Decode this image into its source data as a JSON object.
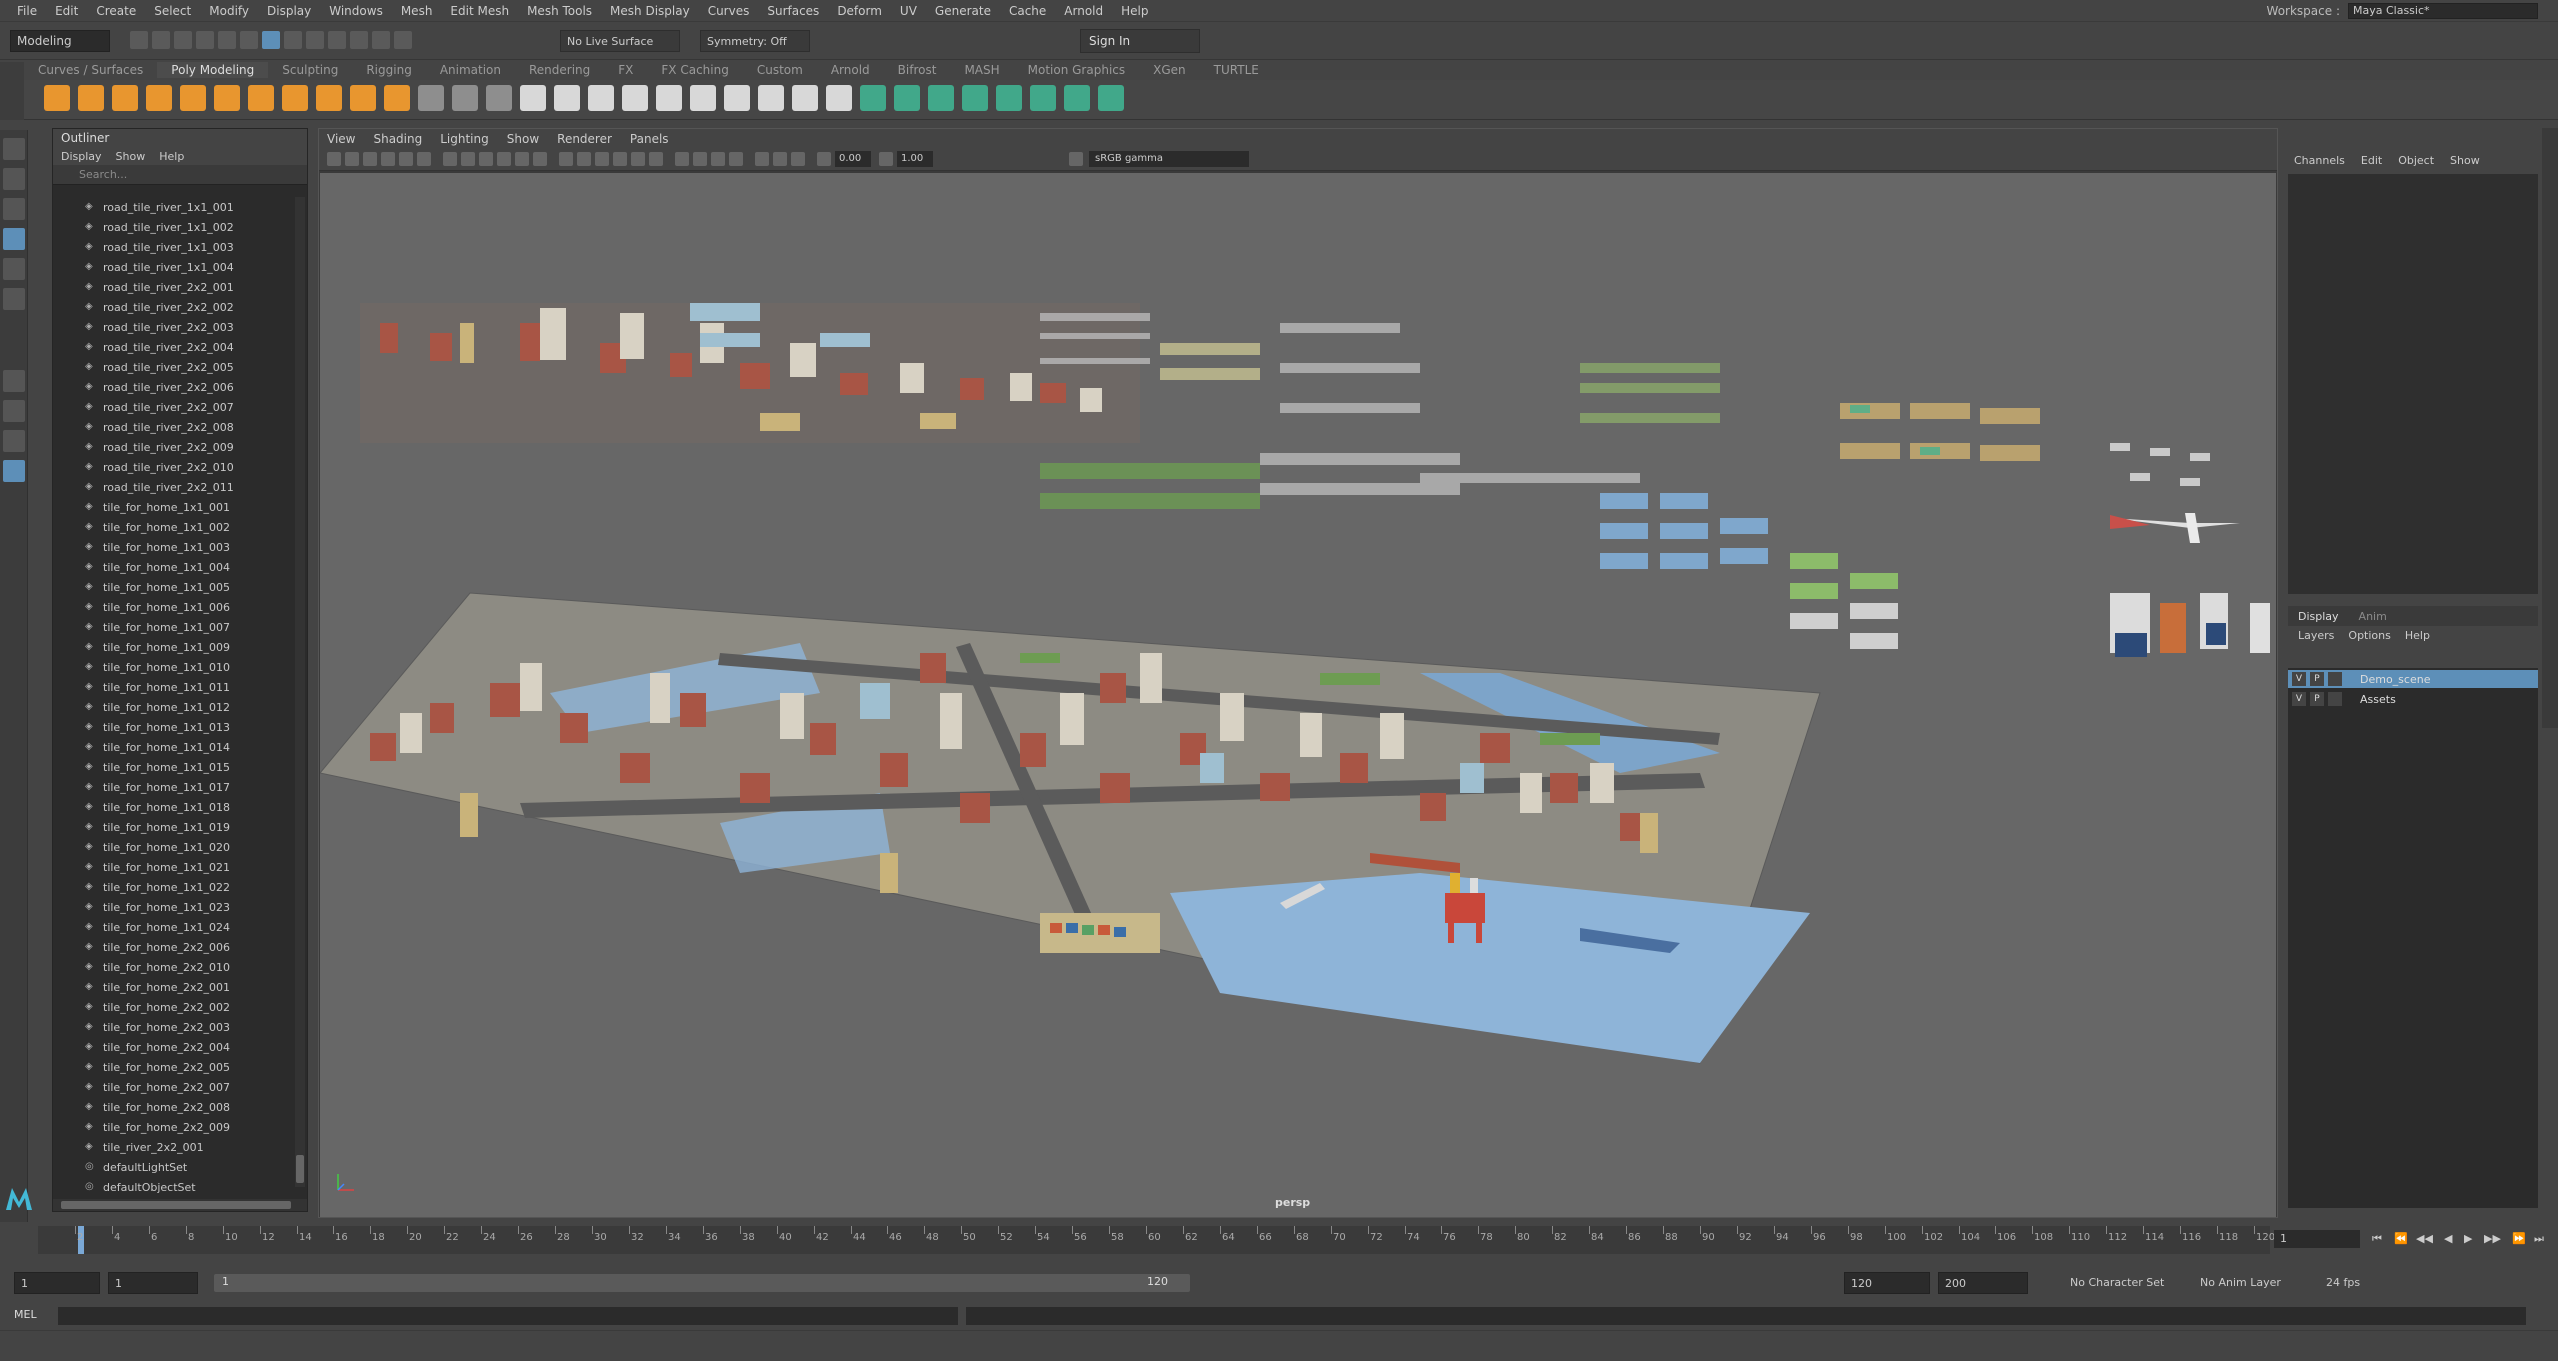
{
  "menu": [
    "File",
    "Edit",
    "Create",
    "Select",
    "Modify",
    "Display",
    "Windows",
    "Mesh",
    "Edit Mesh",
    "Mesh Tools",
    "Mesh Display",
    "Curves",
    "Surfaces",
    "Deform",
    "UV",
    "Generate",
    "Cache",
    "Arnold",
    "Help"
  ],
  "workspace": {
    "label": "Workspace :",
    "value": "Maya Classic*"
  },
  "status_line": {
    "mode": "Modeling",
    "live_surface": "No Live Surface",
    "symmetry": "Symmetry: Off",
    "sign_in": "Sign In"
  },
  "shelf_tabs": [
    "Curves / Surfaces",
    "Poly Modeling",
    "Sculpting",
    "Rigging",
    "Animation",
    "Rendering",
    "FX",
    "FX Caching",
    "Custom",
    "Arnold",
    "Bifrost",
    "MASH",
    "Motion Graphics",
    "XGen",
    "TURTLE"
  ],
  "shelf_active": "Poly Modeling",
  "outliner": {
    "title": "Outliner",
    "menu": [
      "Display",
      "Show",
      "Help"
    ],
    "search_placeholder": "Search...",
    "items": [
      "road_tile_river_1x1_001",
      "road_tile_river_1x1_002",
      "road_tile_river_1x1_003",
      "road_tile_river_1x1_004",
      "road_tile_river_2x2_001",
      "road_tile_river_2x2_002",
      "road_tile_river_2x2_003",
      "road_tile_river_2x2_004",
      "road_tile_river_2x2_005",
      "road_tile_river_2x2_006",
      "road_tile_river_2x2_007",
      "road_tile_river_2x2_008",
      "road_tile_river_2x2_009",
      "road_tile_river_2x2_010",
      "road_tile_river_2x2_011",
      "tile_for_home_1x1_001",
      "tile_for_home_1x1_002",
      "tile_for_home_1x1_003",
      "tile_for_home_1x1_004",
      "tile_for_home_1x1_005",
      "tile_for_home_1x1_006",
      "tile_for_home_1x1_007",
      "tile_for_home_1x1_009",
      "tile_for_home_1x1_010",
      "tile_for_home_1x1_011",
      "tile_for_home_1x1_012",
      "tile_for_home_1x1_013",
      "tile_for_home_1x1_014",
      "tile_for_home_1x1_015",
      "tile_for_home_1x1_017",
      "tile_for_home_1x1_018",
      "tile_for_home_1x1_019",
      "tile_for_home_1x1_020",
      "tile_for_home_1x1_021",
      "tile_for_home_1x1_022",
      "tile_for_home_1x1_023",
      "tile_for_home_1x1_024",
      "tile_for_home_2x2_006",
      "tile_for_home_2x2_010",
      "tile_for_home_2x2_001",
      "tile_for_home_2x2_002",
      "tile_for_home_2x2_003",
      "tile_for_home_2x2_004",
      "tile_for_home_2x2_005",
      "tile_for_home_2x2_007",
      "tile_for_home_2x2_008",
      "tile_for_home_2x2_009",
      "tile_river_2x2_001",
      "defaultLightSet",
      "defaultObjectSet"
    ]
  },
  "viewport": {
    "menu": [
      "View",
      "Shading",
      "Lighting",
      "Show",
      "Renderer",
      "Panels"
    ],
    "exposure": "0.00",
    "gamma": "1.00",
    "color_space": "sRGB gamma",
    "camera": "persp"
  },
  "channel_box": {
    "menu": [
      "Channels",
      "Edit",
      "Object",
      "Show"
    ],
    "display_tabs": [
      "Display",
      "Anim"
    ],
    "layer_menu": [
      "Layers",
      "Options",
      "Help"
    ],
    "layers": [
      {
        "v": "V",
        "p": "P",
        "name": "Demo_scene",
        "selected": true
      },
      {
        "v": "V",
        "p": "P",
        "name": "Assets",
        "selected": false
      }
    ]
  },
  "time_slider": {
    "ticks": [
      "2",
      "4",
      "6",
      "8",
      "10",
      "12",
      "14",
      "16",
      "18",
      "20",
      "22",
      "24",
      "26",
      "28",
      "30",
      "32",
      "34",
      "36",
      "38",
      "40",
      "42",
      "44",
      "46",
      "48",
      "50",
      "52",
      "54",
      "56",
      "58",
      "60",
      "62",
      "64",
      "66",
      "68",
      "70",
      "72",
      "74",
      "76",
      "78",
      "80",
      "82",
      "84",
      "86",
      "88",
      "90",
      "92",
      "94",
      "96",
      "98",
      "100",
      "102",
      "104",
      "106",
      "108",
      "110",
      "112",
      "114",
      "116",
      "118",
      "120"
    ],
    "current_frame": "1"
  },
  "range": {
    "start": "1",
    "anim_start": "1",
    "slider_start": "1",
    "slider_end": "120",
    "end": "120",
    "anim_end": "200",
    "character_set": "No Character Set",
    "anim_layer": "No Anim Layer",
    "fps": "24 fps"
  },
  "command_line": {
    "label": "MEL"
  },
  "colors": {
    "accent": "#5d8fb8",
    "water": "#8eb4d8",
    "viewport_bg": "#676767"
  }
}
